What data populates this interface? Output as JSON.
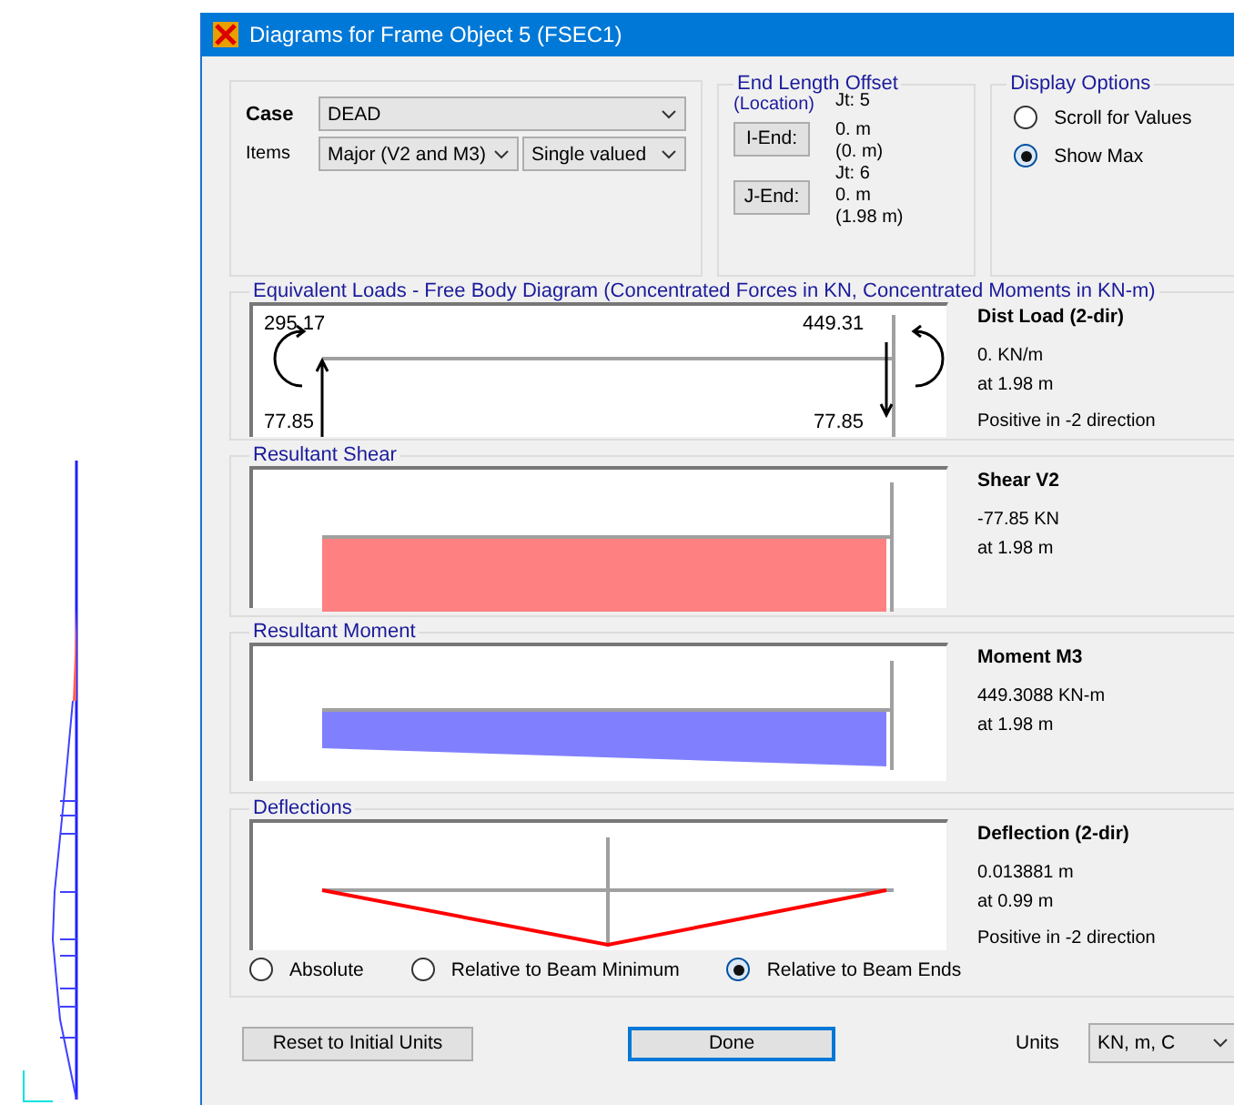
{
  "window": {
    "title": "Diagrams for Frame Object 5  (FSEC1)"
  },
  "case": {
    "label": "Case",
    "value": "DEAD"
  },
  "items": {
    "label": "Items",
    "component": "Major (V2 and M3)",
    "valued": "Single valued"
  },
  "end_length_offset": {
    "title": "End Length Offset",
    "subtitle": "(Location)",
    "ends": [
      {
        "button": "I-End:",
        "joint": "Jt:  5",
        "offset": "0. m",
        "location": "(0. m)"
      },
      {
        "button": "J-End:",
        "joint": "Jt:  6",
        "offset": "0. m",
        "location": "(1.98 m)"
      }
    ]
  },
  "display_options": {
    "title": "Display Options",
    "options": [
      {
        "label": "Scroll for Values",
        "selected": false
      },
      {
        "label": "Show Max",
        "selected": true
      }
    ]
  },
  "diagrams": [
    {
      "kind": "free_body",
      "title": "Equivalent Loads - Free Body Diagram  (Concentrated Forces in KN, Concentrated Moments in KN-m)",
      "left_moment": "295.17",
      "right_moment": "449.31",
      "left_force": "77.85",
      "right_force": "77.85",
      "info_title": "Dist Load (2-dir)",
      "info_lines": [
        "0. KN/m",
        "at 1.98 m",
        "Positive in -2 direction"
      ]
    },
    {
      "kind": "shear",
      "title": "Resultant Shear",
      "info_title": "Shear V2",
      "info_lines": [
        "-77.85 KN",
        "at 1.98 m"
      ]
    },
    {
      "kind": "moment",
      "title": "Resultant Moment",
      "info_title": "Moment M3",
      "info_lines": [
        "449.3088 KN-m",
        "at 1.98 m"
      ]
    },
    {
      "kind": "deflection",
      "title": "Deflections",
      "info_title": "Deflection (2-dir)",
      "info_lines": [
        "0.013881 m",
        "at 0.99 m",
        "Positive in -2 direction"
      ]
    }
  ],
  "deflection_modes": [
    {
      "label": "Absolute",
      "selected": false
    },
    {
      "label": "Relative to Beam Minimum",
      "selected": false
    },
    {
      "label": "Relative to Beam Ends",
      "selected": true
    }
  ],
  "buttons": {
    "reset": "Reset to Initial Units",
    "done": "Done"
  },
  "units": {
    "label": "Units",
    "value": "KN, m, C"
  }
}
